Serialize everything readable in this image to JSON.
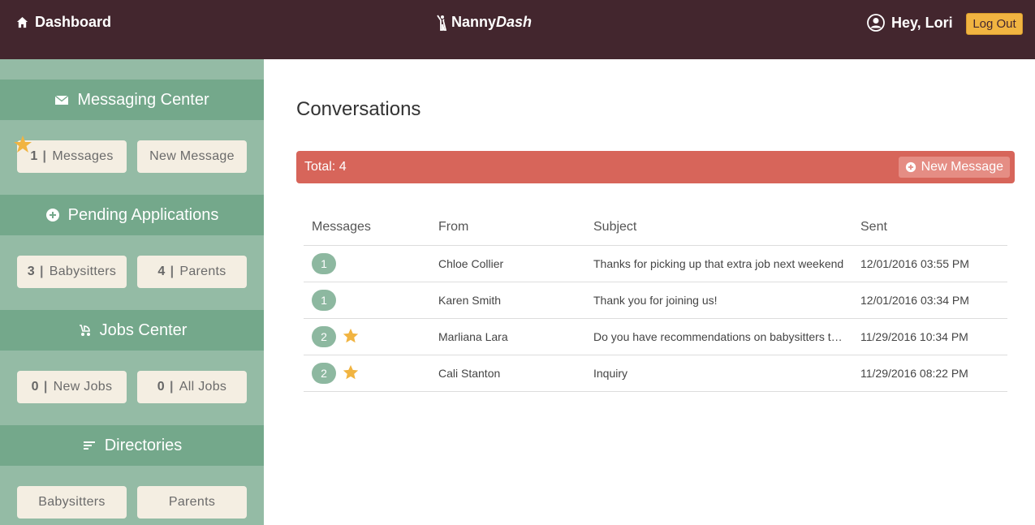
{
  "topbar": {
    "dashboard_label": "Dashboard",
    "logo_first": "Nanny",
    "logo_second": "Dash",
    "greeting": "Hey, Lori",
    "logout_label": "Log Out"
  },
  "sidebar": {
    "messaging": {
      "title": "Messaging Center",
      "messages_count": "1",
      "messages_label": "Messages",
      "new_message_label": "New Message"
    },
    "pending": {
      "title": "Pending Applications",
      "babysitters_count": "3",
      "babysitters_label": "Babysitters",
      "parents_count": "4",
      "parents_label": "Parents"
    },
    "jobs": {
      "title": "Jobs Center",
      "new_jobs_count": "0",
      "new_jobs_label": "New Jobs",
      "all_jobs_count": "0",
      "all_jobs_label": "All Jobs"
    },
    "directories": {
      "title": "Directories",
      "babysitters_label": "Babysitters",
      "parents_label": "Parents"
    }
  },
  "main": {
    "title": "Conversations",
    "total_label": "Total: 4",
    "new_message_label": "New Message",
    "columns": [
      "Messages",
      "From",
      "Subject",
      "Sent"
    ],
    "rows": [
      {
        "count": "1",
        "starred": false,
        "from": "Chloe Collier",
        "subject": "Thanks for picking up that extra job next weekend",
        "sent": "12/01/2016 03:55 PM"
      },
      {
        "count": "1",
        "starred": false,
        "from": "Karen Smith",
        "subject": "Thank you for joining us!",
        "sent": "12/01/2016 03:34 PM"
      },
      {
        "count": "2",
        "starred": true,
        "from": "Marliana Lara",
        "subject": "Do you have recommendations on babysitters to…",
        "sent": "11/29/2016 10:34 PM"
      },
      {
        "count": "2",
        "starred": true,
        "from": "Cali Stanton",
        "subject": "Inquiry",
        "sent": "11/29/2016 08:22 PM"
      }
    ]
  },
  "colors": {
    "topbar": "#43262e",
    "sidebar": "#94bba5",
    "section_header": "#74a88b",
    "pill": "#f4eee2",
    "total_bar": "#d7655a",
    "logout": "#f1b441",
    "star": "#f1b441"
  },
  "icons": {
    "dashboard": "home-icon",
    "logo": "nanny-figure-icon",
    "user": "user-circle-icon",
    "messaging": "envelope-icon",
    "pending": "plus-circle-icon",
    "jobs": "stroller-icon",
    "directories": "list-icon",
    "star": "star-icon"
  }
}
